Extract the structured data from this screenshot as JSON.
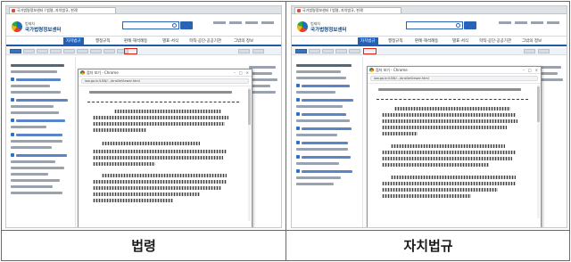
{
  "browser": {
    "tab_title": "국가법령정보센터 ⅼ 법령, 자치법규, 판례",
    "popup_title": "점자 보기 - Chrome",
    "popup_url": "law.go.kr/LSW/.../brailleViewer.html"
  },
  "site": {
    "logo_subtitle": "법제처",
    "logo_name": "국가법령정보센터",
    "nav_left": [
      "자치법규",
      "행정규칙",
      "판례·해석례등",
      "별표·서식",
      "학칙·공단·공공기관",
      "그밖의 정보"
    ],
    "nav_right": [
      "자치법규",
      "행정규칙",
      "판례·해석례등",
      "별표·서식",
      "학칙·공단·공공기관",
      "그밖의 정보"
    ],
    "active_nav_left": "자치법규",
    "active_nav_right": "자치법규"
  },
  "highlight_color": "#e2231a",
  "captions": {
    "left": "법령",
    "right": "자치법규"
  }
}
